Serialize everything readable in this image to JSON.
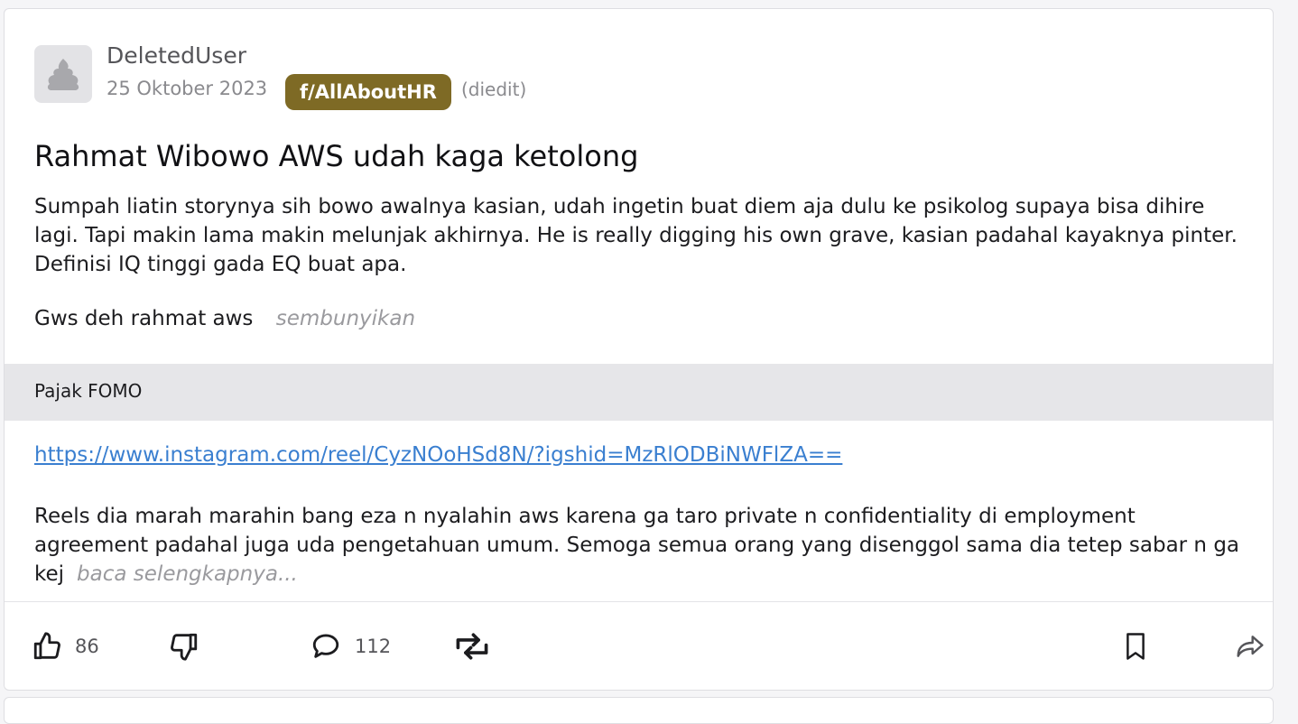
{
  "post": {
    "author": "DeletedUser",
    "date": "25 Oktober 2023",
    "community": "f/AllAboutHR",
    "edited_label": "(diedit)",
    "title": "Rahmat Wibowo AWS udah kaga ketolong",
    "body": "Sumpah liatin storynya sih bowo awalnya kasian, udah ingetin buat diem aja dulu ke psikolog supaya bisa dihire lagi. Tapi makin lama makin melunjak akhirnya. He is really digging his own grave, kasian padahal kayaknya pinter. Definisi IQ tinggi gada EQ buat apa.",
    "sign_off": "Gws deh rahmat aws",
    "hide_label": "sembunyikan"
  },
  "quoted_post": {
    "title": "Pajak FOMO",
    "link": "https://www.instagram.com/reel/CyzNOoHSd8N/?igshid=MzRlODBiNWFlZA==",
    "excerpt": "Reels dia marah marahin bang eza n nyalahin aws karena ga taro private n confidentiality di employment agreement padahal juga uda pengetahuan umum. Semoga semua orang yang disenggol sama dia tetep sabar n ga kej",
    "read_more_label": "baca selengkapnya..."
  },
  "actions": {
    "likes": "86",
    "comments": "112",
    "icons": [
      "thumbs-up-icon",
      "thumbs-down-icon",
      "comment-icon",
      "repost-icon",
      "bookmark-icon",
      "share-icon"
    ]
  },
  "colors": {
    "community_badge": "#7e6a25",
    "link": "#3a7fd0",
    "quote_header_bg": "#e6e6e9"
  }
}
